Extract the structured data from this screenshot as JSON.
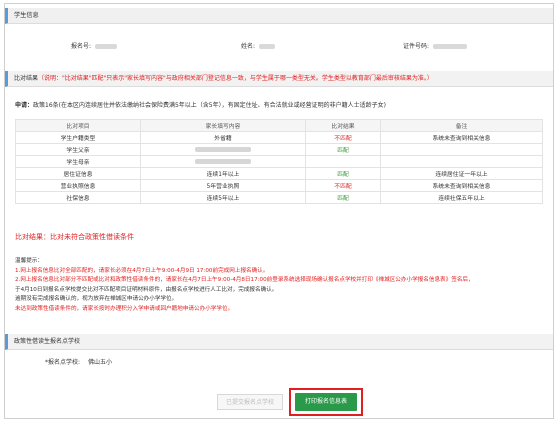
{
  "student_section": {
    "title": "学生信息",
    "fields": [
      {
        "label": "报名号:"
      },
      {
        "label": "姓名:"
      },
      {
        "label": "证件号码:"
      }
    ]
  },
  "compare_section": {
    "title_label": "比对结果",
    "title_note": "（说明：\"比对结果\"匹配\"只表示\"家长填写内容\"与政府相关部门登记信息一致，与学生属于哪一类型无关。学生类型以教育部门最后审核结果为准。）"
  },
  "apply_line": {
    "prefix": "申请：",
    "text": "政策16条(在本区内连续居住并依法缴纳社会保险费满5年以上（含5年），有固定住址、有合法就业或经营证明的非户籍人士适龄子女)"
  },
  "table": {
    "headers": [
      "比对项目",
      "家长填写内容",
      "比对结果",
      "备注"
    ],
    "rows": [
      {
        "item": "学生户籍类型",
        "content": "外省籍",
        "result": "不匹配",
        "result_type": "mismatch",
        "remark": "系统未查询到相关信息"
      },
      {
        "item": "学生父亲",
        "content": "",
        "result": "匹配",
        "result_type": "match",
        "remark": ""
      },
      {
        "item": "学生母亲",
        "content": "",
        "result": "",
        "result_type": "none",
        "remark": ""
      },
      {
        "item": "居住证信息",
        "content": "连续1年以上",
        "result": "匹配",
        "result_type": "match",
        "remark": "连续居住证一年以上"
      },
      {
        "item": "营业执照信息",
        "content": "5年营业执照",
        "result": "不匹配",
        "result_type": "mismatch",
        "remark": "系统未查询到相关信息"
      },
      {
        "item": "社保信息",
        "content": "连续5年以上",
        "result": "匹配",
        "result_type": "match",
        "remark": "连续社保五年以上"
      }
    ]
  },
  "result_text": "比对结果：比对未符合政策性借读条件",
  "tips": {
    "title": "温馨提示：",
    "line1": "1.网上报名信息比对全部匹配的，请家长必须在4月7日上午9:00-4月9日 17:00前完成网上报名确认。",
    "line2a": "2.网上报名信息比对部分不匹配或比对和政策性借读条件的，请家长在4月7日上午9:00-4月8日17:00前登录系统选择现场确认报名点学校并打印《禅城区公办小学报名信息表》签名后，",
    "line2b": "于4月10日到报名点学校提交比对不匹配项目证明材料原件，由报名点学校进行人工比对，完成报名确认。",
    "line3": "逾期没有完成报名确认的，视为放弃在禅城区申请公办小学学位。",
    "line4": "未达到政策性借读条件的，请家长按时办理积分入学申请或回户籍地申请公办小学学位。"
  },
  "school_section": {
    "title": "政策性借读生报名点学校",
    "label": "*报名点学校:",
    "value": "佛山五小"
  },
  "buttons": {
    "submitted": "已提交报名点学校",
    "print": "打印报名信息表"
  },
  "colors": {
    "accent_bar": "#5b9bd5",
    "mismatch": "#e02020",
    "match": "#2a9a2a",
    "print_button": "#2a9a4a"
  }
}
